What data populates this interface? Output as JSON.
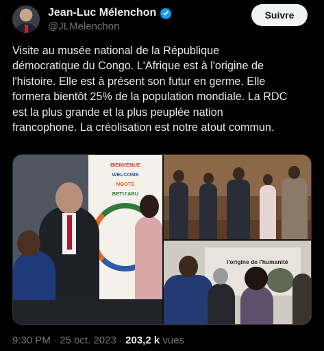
{
  "author": {
    "display_name": "Jean-Luc Mélenchon",
    "handle": "@JLMelenchon",
    "verified_icon": "verified-badge-icon",
    "verified_color": "#1d9bf0"
  },
  "follow_button": {
    "label": "Suivre"
  },
  "tweet": {
    "lines": [
      "Visite au musée national de la République",
      "démocratique du Congo. L'Afrique est à l'origine de",
      "l'histoire. Elle est à présent son futur en germe. Elle",
      "formera bientôt 25% de la population mondiale. La RDC",
      "est la plus grande et la plus peuplée nation",
      "francophone. La créolisation est notre atout commun."
    ]
  },
  "media": {
    "photo1_banner": [
      "BIENVENUE",
      "WELCOME",
      "MBOTE",
      "BETU'ABU"
    ],
    "photo3_screen_text": "l'origine de l'humanité"
  },
  "footer": {
    "time": "9:30 PM",
    "separator": " · ",
    "date": "25 oct. 2023",
    "views_count": "203,2 k",
    "views_label": " vues"
  },
  "colors": {
    "background": "#000000",
    "text": "#e7e9ea",
    "muted": "#71767b",
    "follow_bg": "#eff3f4"
  }
}
